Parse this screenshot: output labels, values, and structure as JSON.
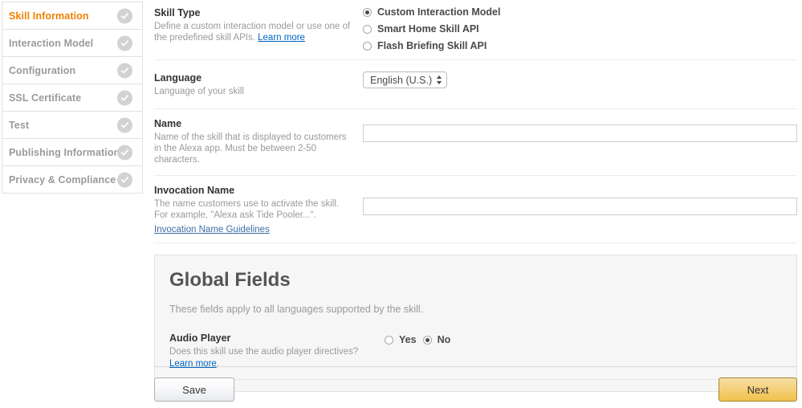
{
  "sidebar": {
    "items": [
      {
        "label": "Skill Information",
        "active": true,
        "status_icon": "check-circle-icon"
      },
      {
        "label": "Interaction Model",
        "active": false,
        "status_icon": "check-circle-icon"
      },
      {
        "label": "Configuration",
        "active": false,
        "status_icon": "check-circle-icon"
      },
      {
        "label": "SSL Certificate",
        "active": false,
        "status_icon": "check-circle-icon"
      },
      {
        "label": "Test",
        "active": false,
        "status_icon": "check-circle-icon"
      },
      {
        "label": "Publishing Information",
        "active": false,
        "status_icon": "check-circle-icon"
      },
      {
        "label": "Privacy & Compliance",
        "active": false,
        "status_icon": "check-circle-icon"
      }
    ]
  },
  "form": {
    "skill_type": {
      "title": "Skill Type",
      "desc": "Define a custom interaction model or use one of the predefined skill APIs. ",
      "learn_more": "Learn more",
      "options": [
        {
          "label": "Custom Interaction Model",
          "selected": true
        },
        {
          "label": "Smart Home Skill API",
          "selected": false
        },
        {
          "label": "Flash Briefing Skill API",
          "selected": false
        }
      ]
    },
    "language": {
      "title": "Language",
      "desc": "Language of your skill",
      "value": "English (U.S.)",
      "options": [
        "English (U.S.)"
      ]
    },
    "name": {
      "title": "Name",
      "desc": "Name of the skill that is displayed to customers in the Alexa app. Must be between 2-50 characters.",
      "value": "",
      "placeholder": ""
    },
    "invocation_name": {
      "title": "Invocation Name",
      "desc": "The name customers use to activate the skill. For example, \"Alexa ask Tide Pooler...\".",
      "guidelines_link": "Invocation Name Guidelines",
      "value": "",
      "placeholder": ""
    }
  },
  "global_fields": {
    "title": "Global Fields",
    "subtitle": "These fields apply to all languages supported by the skill.",
    "audio_player": {
      "title": "Audio Player",
      "desc": "Does this skill use the audio player directives?",
      "learn_more": "Learn more",
      "learn_more_suffix": ".",
      "options": [
        {
          "label": "Yes",
          "selected": false
        },
        {
          "label": "No",
          "selected": true
        }
      ]
    }
  },
  "footer": {
    "save_label": "Save",
    "next_label": "Next"
  },
  "colors": {
    "accent_orange": "#f08000",
    "next_button": "#f0c14b",
    "link_blue": "#0066c0",
    "muted_text": "#9a9a9a",
    "check_gray": "#d2d2d2"
  }
}
